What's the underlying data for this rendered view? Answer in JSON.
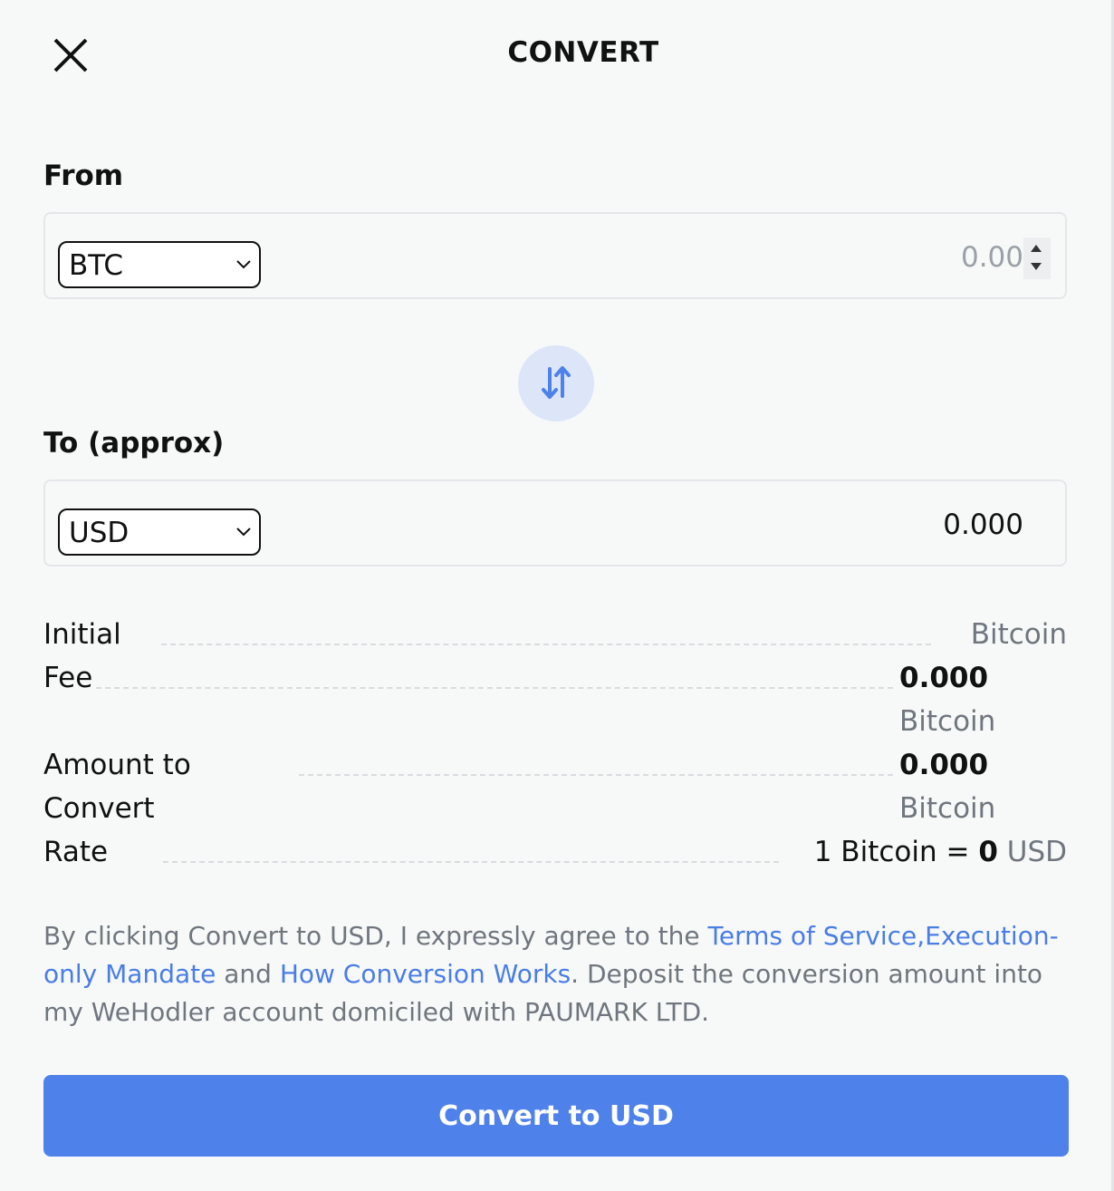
{
  "header": {
    "title": "CONVERT",
    "close_icon": "close-icon"
  },
  "from": {
    "label": "From",
    "currency": "BTC",
    "amount_placeholder": "0.00"
  },
  "swap": {
    "icon": "swap-arrows-icon"
  },
  "to": {
    "label": "To (approx)",
    "currency": "USD",
    "amount": "0.000"
  },
  "details": {
    "initial_label": "Initial",
    "initial_unit": "Bitcoin",
    "fee_label": "Fee",
    "fee_value": "0.000",
    "fee_unit": "Bitcoin",
    "amount_label_line1": "Amount to",
    "amount_label_line2": "Convert",
    "amount_value": "0.000",
    "amount_unit": "Bitcoin",
    "rate_label": "Rate",
    "rate_prefix": "1 Bitcoin = ",
    "rate_value": "0",
    "rate_unit": "USD"
  },
  "agreement": {
    "text_1": "By clicking Convert to USD, I expressly agree to the ",
    "link_terms": "Terms of Service,",
    "link_mandate": "Execution-only Mandate",
    "text_2": " and ",
    "link_how": "How Conversion Works",
    "text_3": ". Deposit the conversion amount into my WeHodler account domiciled with PAUMARK LTD."
  },
  "convert_button": "Convert to USD",
  "colors": {
    "accent": "#4f81ea",
    "link": "#4a7de6",
    "swap_bg": "#dce6f8",
    "background": "#f7f9f9",
    "muted_text": "#6f767d"
  }
}
